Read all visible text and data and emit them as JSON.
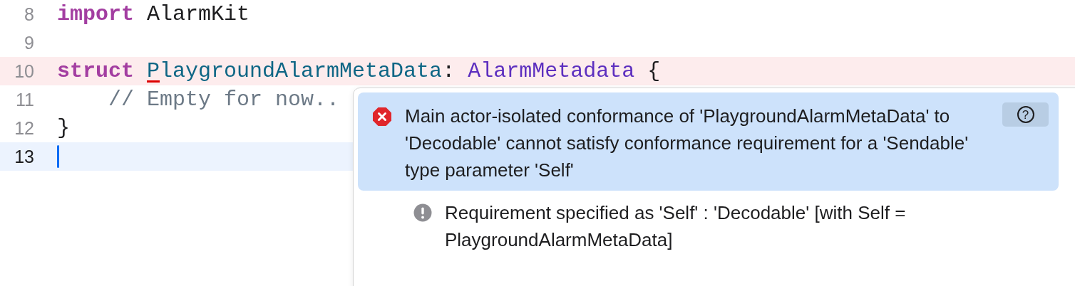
{
  "editor": {
    "lines": [
      {
        "number": "8",
        "error": false,
        "current": false,
        "tokens": [
          {
            "kind": "keyword",
            "text": "import"
          },
          {
            "kind": "plain",
            "text": " AlarmKit"
          }
        ]
      },
      {
        "number": "9",
        "error": false,
        "current": false
      },
      {
        "number": "10",
        "error": true,
        "current": false,
        "tokens": [
          {
            "kind": "keyword",
            "text": "struct "
          },
          {
            "kind": "type",
            "text": "P",
            "underlined": true
          },
          {
            "kind": "type",
            "text": "laygroundAlarmMetaData",
            "underlined": false
          },
          {
            "kind": "plain",
            "text": ": "
          },
          {
            "kind": "protocol",
            "text": "AlarmMetadata"
          },
          {
            "kind": "plain",
            "text": " {"
          }
        ]
      },
      {
        "number": "11",
        "error": false,
        "current": false,
        "tokens": [
          {
            "kind": "comment",
            "text": "    // Empty for now.."
          }
        ]
      },
      {
        "number": "12",
        "error": false,
        "current": false,
        "tokens": [
          {
            "kind": "plain",
            "text": "}"
          }
        ]
      },
      {
        "number": "13",
        "error": false,
        "current": true
      }
    ]
  },
  "issue_popover": {
    "issues": [
      {
        "kind": "error",
        "selected": true,
        "message": "Main actor-isolated conformance of 'PlaygroundAlarmMetaData' to 'Decodable' cannot satisfy conformance requirement for a 'Sendable' type parameter 'Self'",
        "help": "?"
      },
      {
        "kind": "note",
        "selected": false,
        "message": "Requirement specified as 'Self' : 'Decodable' [with Self = PlaygroundAlarmMetaData]"
      }
    ]
  }
}
